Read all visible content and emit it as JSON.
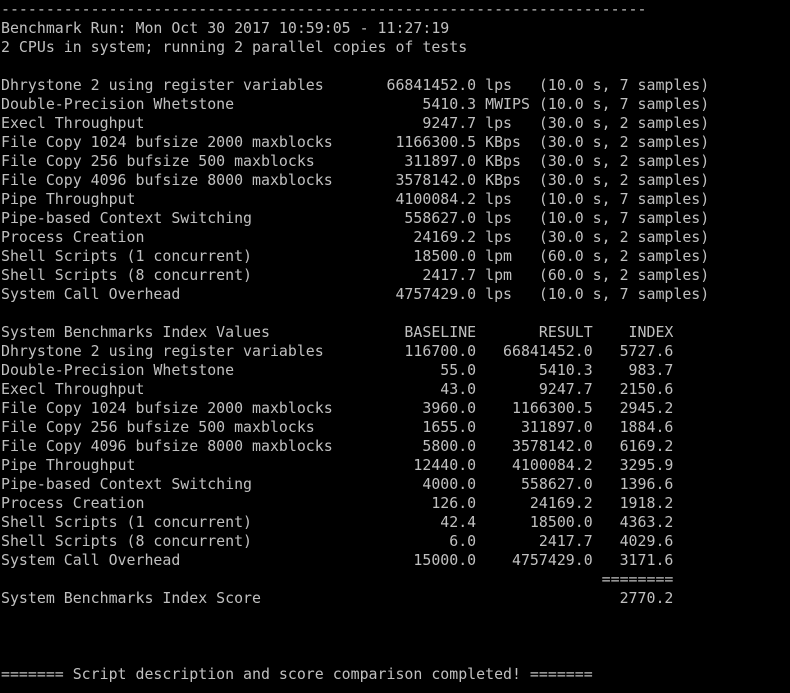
{
  "terminal": {
    "lines": [
      "------------------------------------------------------------------------",
      "Benchmark Run: Mon Oct 30 2017 10:59:05 - 11:27:19",
      "2 CPUs in system; running 2 parallel copies of tests",
      "",
      "Dhrystone 2 using register variables       66841452.0 lps   (10.0 s, 7 samples)",
      "Double-Precision Whetstone                     5410.3 MWIPS (10.0 s, 7 samples)",
      "Execl Throughput                               9247.7 lps   (30.0 s, 2 samples)",
      "File Copy 1024 bufsize 2000 maxblocks       1166300.5 KBps  (30.0 s, 2 samples)",
      "File Copy 256 bufsize 500 maxblocks          311897.0 KBps  (30.0 s, 2 samples)",
      "File Copy 4096 bufsize 8000 maxblocks       3578142.0 KBps  (30.0 s, 2 samples)",
      "Pipe Throughput                             4100084.2 lps   (10.0 s, 7 samples)",
      "Pipe-based Context Switching                 558627.0 lps   (10.0 s, 7 samples)",
      "Process Creation                              24169.2 lps   (30.0 s, 2 samples)",
      "Shell Scripts (1 concurrent)                  18500.0 lpm   (60.0 s, 2 samples)",
      "Shell Scripts (8 concurrent)                   2417.7 lpm   (60.0 s, 2 samples)",
      "System Call Overhead                        4757429.0 lps   (10.0 s, 7 samples)",
      "",
      "System Benchmarks Index Values               BASELINE       RESULT    INDEX",
      "Dhrystone 2 using register variables         116700.0   66841452.0   5727.6",
      "Double-Precision Whetstone                       55.0       5410.3    983.7",
      "Execl Throughput                                 43.0       9247.7   2150.6",
      "File Copy 1024 bufsize 2000 maxblocks          3960.0    1166300.5   2945.2",
      "File Copy 256 bufsize 500 maxblocks            1655.0     311897.0   1884.6",
      "File Copy 4096 bufsize 8000 maxblocks          5800.0    3578142.0   6169.2",
      "Pipe Throughput                               12440.0    4100084.2   3295.9",
      "Pipe-based Context Switching                   4000.0     558627.0   1396.6",
      "Process Creation                                126.0      24169.2   1918.2",
      "Shell Scripts (1 concurrent)                     42.4      18500.0   4363.2",
      "Shell Scripts (8 concurrent)                      6.0       2417.7   4029.6",
      "System Call Overhead                          15000.0    4757429.0   3171.6",
      "                                                                   ========",
      "System Benchmarks Index Score                                        2770.2",
      "",
      "",
      "",
      "======= Script description and score comparison completed! ======="
    ]
  }
}
